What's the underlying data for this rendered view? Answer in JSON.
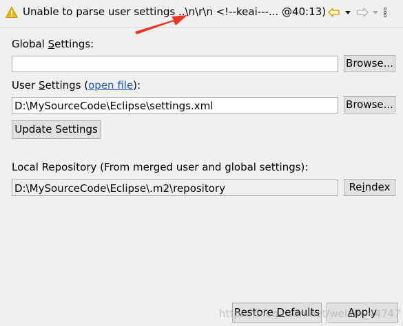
{
  "title": {
    "text": "Unable to parse user settings ..\\n\\r\\n <!--keai---... @40:13)"
  },
  "colors": {
    "warning": "#f0b400",
    "arrow": "#ee3322",
    "link": "#1a5dbd"
  },
  "global_settings": {
    "label_pre": "Global ",
    "label_mnemonic": "S",
    "label_post": "ettings:",
    "value": "",
    "browse_label": "Browse..."
  },
  "user_settings": {
    "label_pre": "User ",
    "label_mnemonic": "S",
    "label_mid": "ettings (",
    "link_text": "open file",
    "label_post": "):",
    "value": "D:\\MySourceCode\\Eclipse\\settings.xml",
    "browse_label": "Browse...",
    "update_label": "Update Settings"
  },
  "local_repository": {
    "label": "Local Repository (From merged user and global settings):",
    "value": "D:\\MySourceCode\\Eclipse\\.m2\\repository",
    "reindex_pre": "Re",
    "reindex_mnemonic": "i",
    "reindex_post": "ndex"
  },
  "footer": {
    "restore_pre": "Restore ",
    "restore_mnemonic": "D",
    "restore_post": "efaults",
    "apply_mnemonic": "A",
    "apply_post": "pply",
    "watermark": "https://blog.csdn.net/weixin_44747"
  }
}
